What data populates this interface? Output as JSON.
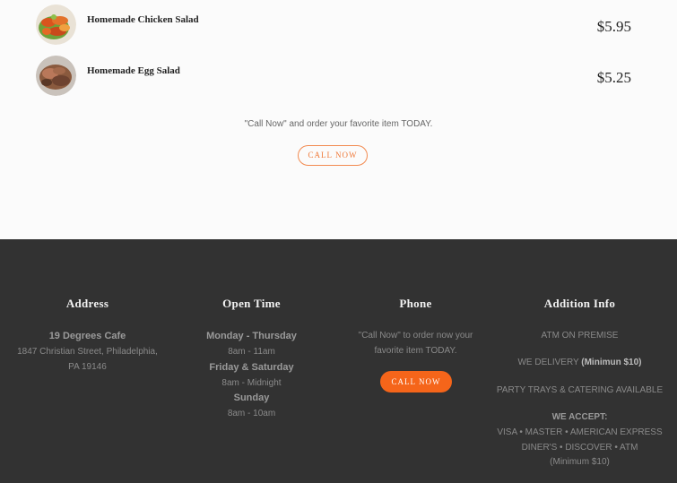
{
  "menu": {
    "items": [
      {
        "name": "Homemade Chicken Salad",
        "price": "$5.95"
      },
      {
        "name": "Homemade Egg Salad",
        "price": "$5.25"
      }
    ],
    "cta_text": "\"Call Now\" and order your favorite item TODAY.",
    "cta_button": "CALL NOW"
  },
  "footer": {
    "address": {
      "title": "Address",
      "name": "19 Degrees Cafe",
      "line1": "1847 Christian Street, Philadelphia,",
      "line2": "PA 19146"
    },
    "hours": {
      "title": "Open Time",
      "day1": "Monday - Thursday",
      "time1": "8am - 11am",
      "day2": "Friday & Saturday",
      "time2": "8am - Midnight",
      "day3": "Sunday",
      "time3": "8am - 10am"
    },
    "phone": {
      "title": "Phone",
      "text1": "\"Call Now\" to order now your",
      "text2": "favorite item TODAY.",
      "button": "CALL NOW"
    },
    "info": {
      "title": "Addition Info",
      "atm": "ATM ON PREMISE",
      "delivery": "WE DELIVERY",
      "delivery_min": "(Minimun $10)",
      "party": "PARTY TRAYS & CATERING AVAILABLE",
      "accept_title": "WE ACCEPT:",
      "cards1": "VISA • MASTER • AMERICAN EXPRESS",
      "cards2": "DINER'S • DISCOVER • ATM",
      "cards_min": "(Minimum $10)"
    }
  },
  "colors": {
    "accent": "#f5651a",
    "footer_bg": "#323232",
    "page_bg": "#fbfbfb"
  }
}
